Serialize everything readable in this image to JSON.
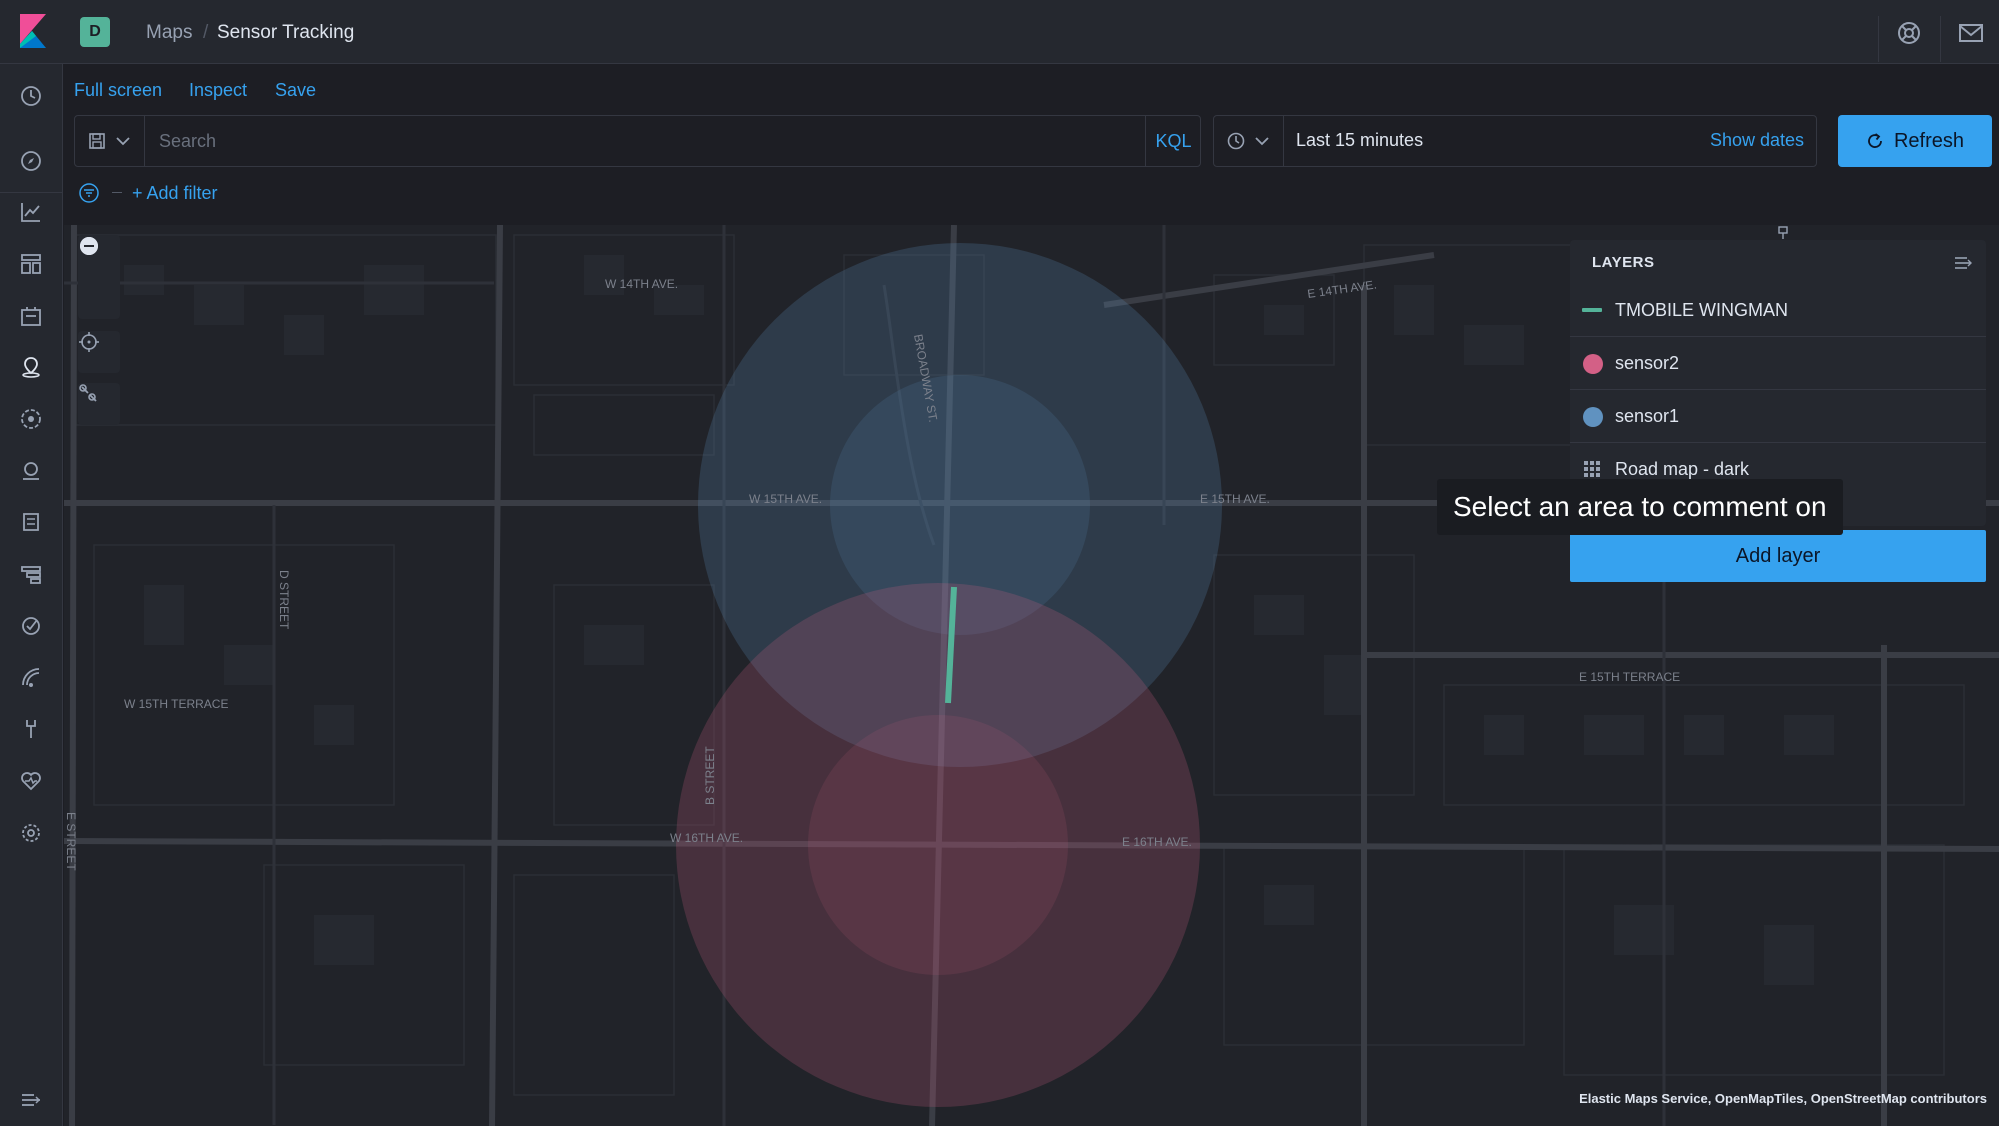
{
  "header": {
    "space_initial": "D",
    "breadcrumb_parent": "Maps",
    "breadcrumb_current": "Sensor Tracking"
  },
  "topnav": {
    "full_screen": "Full screen",
    "inspect": "Inspect",
    "save": "Save"
  },
  "query": {
    "search_placeholder": "Search",
    "kql": "KQL",
    "time_range": "Last 15 minutes",
    "show_dates": "Show dates",
    "refresh": "Refresh",
    "add_filter": "+ Add filter"
  },
  "map": {
    "streets": {
      "w14": "W 14TH AVE.",
      "e14": "E 14TH AVE.",
      "broadway": "BROADWAY ST.",
      "w15": "W 15TH AVE.",
      "e15": "E 15TH AVE.",
      "dstreet": "D STREET",
      "w15terrace": "W 15TH TERRACE",
      "e15terrace": "E 15TH TERRACE",
      "bstreet": "B STREET",
      "w16": "W 16TH AVE.",
      "e16": "E 16TH AVE.",
      "estreet": "E STREET"
    },
    "attribution": "Elastic Maps Service, OpenMapTiles, OpenStreetMap contributors"
  },
  "layers": {
    "title": "LAYERS",
    "items": [
      {
        "label": "TMOBILE WINGMAN",
        "kind": "line",
        "color": "#54b399"
      },
      {
        "label": "sensor2",
        "kind": "point",
        "color": "#d36086"
      },
      {
        "label": "sensor1",
        "kind": "point",
        "color": "#6092c0"
      },
      {
        "label": "Road map - dark",
        "kind": "tiles",
        "color": "#98a2b3"
      }
    ],
    "add_layer": "Add layer"
  },
  "tooltip": "Select an area to comment on",
  "colors": {
    "accent": "#36a2ef",
    "sensor1": "#6092c0",
    "sensor2": "#d36086",
    "wingman": "#54b399"
  }
}
